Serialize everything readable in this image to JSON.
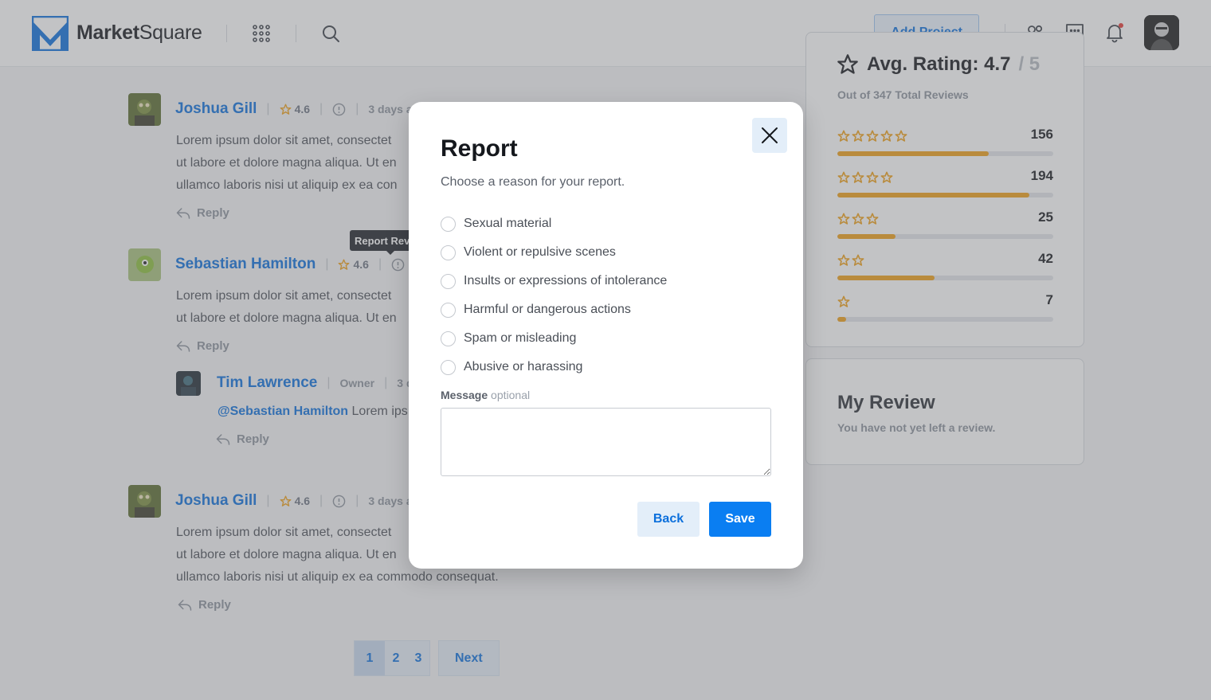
{
  "header": {
    "logo_bold": "Market",
    "logo_light": "Square",
    "add_project_label": "Add Project",
    "icons": [
      "apps-grid-icon",
      "search-icon",
      "users-icon",
      "chat-icon",
      "bell-icon"
    ],
    "accent": "#0b6fdc"
  },
  "reviews": [
    {
      "name": "Joshua Gill",
      "rating": "4.6",
      "meta": "3 days ag",
      "text_lines": [
        "Lorem ipsum dolor sit amet, consectet",
        "ut labore et dolore magna aliqua. Ut en",
        "ullamco laboris nisi ut aliquip ex ea con"
      ],
      "reply_label": "Reply"
    },
    {
      "name": "Sebastian Hamilton",
      "rating": "4.6",
      "text_lines": [
        "Lorem ipsum dolor sit amet, consectet",
        "ut labore et dolore magna aliqua. Ut en"
      ],
      "reply_label": "Reply",
      "reply": {
        "name": "Tim Lawrence",
        "role": "Owner",
        "meta": "3 d",
        "mention": "@Sebastian Hamilton",
        "text": " Lorem ips",
        "reply_label": "Reply"
      }
    },
    {
      "name": "Joshua Gill",
      "rating": "4.6",
      "meta": "3 days ag",
      "text_lines": [
        "Lorem ipsum dolor sit amet, consectet",
        "ut labore et dolore magna aliqua. Ut en",
        "ullamco laboris nisi ut aliquip ex ea commodo consequat."
      ],
      "reply_label": "Reply"
    }
  ],
  "tooltip": "Report Rev",
  "pagination": {
    "pages": [
      "1",
      "2",
      "3"
    ],
    "active": "1",
    "next_label": "Next"
  },
  "rating_summary": {
    "title": "Avg. Rating: 4.7",
    "suffix": "/ 5",
    "total": "Out of 347 Total Reviews",
    "distribution": [
      {
        "stars": 5,
        "count": "156",
        "fill": 0.7
      },
      {
        "stars": 4,
        "count": "194",
        "fill": 0.89
      },
      {
        "stars": 3,
        "count": "25",
        "fill": 0.27
      },
      {
        "stars": 2,
        "count": "42",
        "fill": 0.45
      },
      {
        "stars": 1,
        "count": "7",
        "fill": 0.04
      }
    ],
    "bar_color": "#ef9f16"
  },
  "my_review": {
    "title": "My Review",
    "subtitle": "You have not yet left a review."
  },
  "modal": {
    "title": "Report",
    "subtitle": "Choose a reason for your report.",
    "options": [
      "Sexual material",
      "Violent or repulsive scenes",
      "Insults or expressions of intolerance",
      "Harmful or dangerous actions",
      "Spam or misleading",
      "Abusive or harassing"
    ],
    "message_label": "Message",
    "message_optional": "optional",
    "message_value": "",
    "back_label": "Back",
    "save_label": "Save"
  }
}
